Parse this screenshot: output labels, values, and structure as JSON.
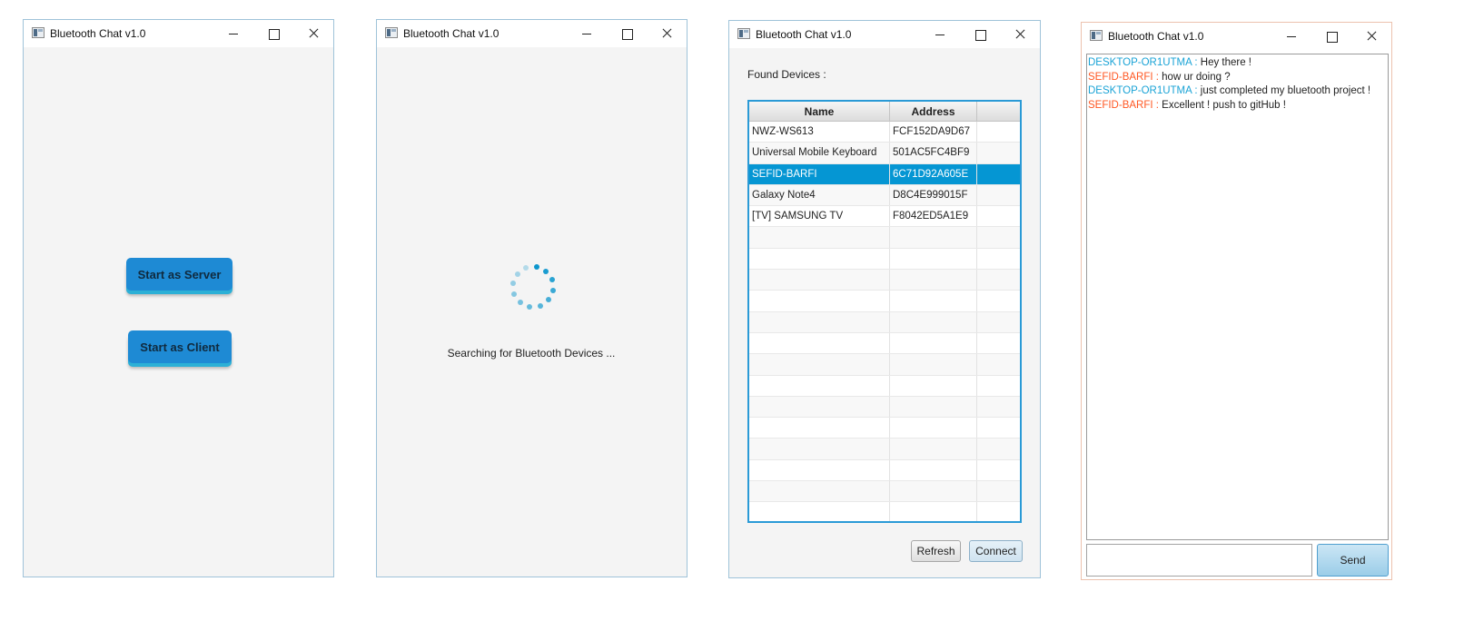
{
  "window_title": "Bluetooth Chat v1.0",
  "start_screen": {
    "server_button": "Start as Server",
    "client_button": "Start as Client"
  },
  "searching_screen": {
    "status_text": "Searching for Bluetooth Devices ..."
  },
  "devices_screen": {
    "found_label": "Found Devices :",
    "columns": [
      "Name",
      "Address"
    ],
    "rows": [
      {
        "name": "NWZ-WS613",
        "address": "FCF152DA9D67"
      },
      {
        "name": "Universal Mobile Keyboard",
        "address": "501AC5FC4BF9"
      },
      {
        "name": "SEFID-BARFI",
        "address": "6C71D92A605E",
        "selected": true
      },
      {
        "name": "Galaxy Note4",
        "address": "D8C4E999015F"
      },
      {
        "name": "[TV] SAMSUNG TV",
        "address": "F8042ED5A1E9"
      }
    ],
    "refresh_button": "Refresh",
    "connect_button": "Connect"
  },
  "chat_screen": {
    "messages": [
      {
        "sender": "DESKTOP-OR1UTMA :",
        "text": " Hey there !",
        "side": "a"
      },
      {
        "sender": "SEFID-BARFI :",
        "text": " how ur doing ?",
        "side": "b"
      },
      {
        "sender": "DESKTOP-OR1UTMA :",
        "text": " just completed my bluetooth project !",
        "side": "a"
      },
      {
        "sender": "SEFID-BARFI :",
        "text": " Excellent ! push to gitHub !",
        "side": "b"
      }
    ],
    "input_value": "",
    "send_button": "Send"
  },
  "colors": {
    "accent": "#0596d3",
    "local_sender": "#1aa3d6",
    "remote_sender": "#ff5722",
    "button_blue": "#1e8ad4"
  }
}
